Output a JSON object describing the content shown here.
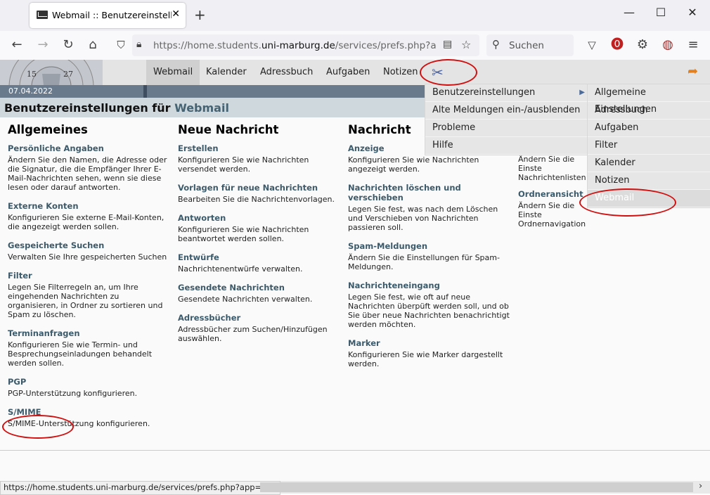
{
  "browser": {
    "tab_title": "Webmail :: Benutzereinstellunge",
    "url_prefix": "https://home.students.",
    "url_domain": "uni-marburg.de",
    "url_path": "/services/prefs.php?app=im",
    "search_placeholder": "Suchen",
    "status_url": "https://home.students.uni-marburg.de/services/prefs.php?app=imp"
  },
  "horde": {
    "seal_numbers": [
      "15",
      "27"
    ],
    "nav": [
      "Webmail",
      "Kalender",
      "Adressbuch",
      "Aufgaben",
      "Notizen"
    ],
    "date": "07.04.2022",
    "page_title_prefix": "Benutzereinstellungen für ",
    "page_title_app": "Webmail"
  },
  "columns": [
    {
      "title": "Allgemeines",
      "items": [
        {
          "label": "Persönliche Angaben",
          "desc": "Ändern Sie den Namen, die Adresse oder die Signatur, die die Empfänger Ihrer E-Mail-Nachrichten sehen, wenn sie diese lesen oder darauf antworten."
        },
        {
          "label": "Externe Konten",
          "desc": "Konfigurieren Sie externe E-Mail-Konten, die angezeigt werden sollen."
        },
        {
          "label": "Gespeicherte Suchen",
          "desc": "Verwalten Sie Ihre gespeicherten Suchen"
        },
        {
          "label": "Filter",
          "desc": "Legen Sie Filterregeln an, um Ihre eingehenden Nachrichten zu organisieren, in Ordner zu sortieren und Spam zu löschen."
        },
        {
          "label": "Terminanfragen",
          "desc": "Konfigurieren Sie wie Termin- und Besprechungseinladungen behandelt werden sollen."
        },
        {
          "label": "PGP",
          "desc": "PGP-Unterstützung konfigurieren."
        },
        {
          "label": "S/MIME",
          "desc": "S/MIME-Unterstützung konfigurieren."
        }
      ]
    },
    {
      "title": "Neue Nachricht",
      "items": [
        {
          "label": "Erstellen",
          "desc": "Konfigurieren Sie wie Nachrichten versendet werden."
        },
        {
          "label": "Vorlagen für neue Nachrichten",
          "desc": "Bearbeiten Sie die Nachrichtenvorlagen."
        },
        {
          "label": "Antworten",
          "desc": "Konfigurieren Sie wie Nachrichten beantwortet werden sollen."
        },
        {
          "label": "Entwürfe",
          "desc": "Nachrichtenentwürfe verwalten."
        },
        {
          "label": "Gesendete Nachrichten",
          "desc": "Gesendete Nachrichten verwalten."
        },
        {
          "label": "Adressbücher",
          "desc": "Adressbücher zum Suchen/Hinzufügen auswählen."
        }
      ]
    },
    {
      "title": "Nachricht",
      "items": [
        {
          "label": "Anzeige",
          "desc": "Konfigurieren Sie wie Nachrichten angezeigt werden."
        },
        {
          "label": "Nachrichten löschen und verschieben",
          "desc": "Legen Sie fest, was nach dem Löschen und Verschieben von Nachrichten passieren soll."
        },
        {
          "label": "Spam-Meldungen",
          "desc": "Ändern Sie die Einstellungen für Spam-Meldungen."
        },
        {
          "label": "Nachrichteneingang",
          "desc": "Legen Sie fest, wie oft auf neue Nachrichten überpüft werden soll, und ob Sie über neue Nachrichten benachrichtigt werden möchten."
        },
        {
          "label": "Marker",
          "desc": "Konfigurieren Sie wie Marker dargestellt werden."
        }
      ]
    },
    {
      "title": "",
      "items": [
        {
          "label": "",
          "desc": "Ändern Sie die Einste Nachrichtenlisten"
        },
        {
          "label": "Ordneransicht",
          "desc": "Ändern Sie die Einste Ordnernavigation"
        }
      ]
    }
  ],
  "menu_main": [
    {
      "label": "Benutzereinstellungen",
      "submenu": true
    },
    {
      "label": "Alte Meldungen ein-/ausblenden",
      "submenu": false
    },
    {
      "label": "Probleme",
      "submenu": false
    },
    {
      "label": "Hilfe",
      "submenu": false
    }
  ],
  "menu_sub": [
    "Allgemeine Einstellungen",
    "Adressbuch",
    "Aufgaben",
    "Filter",
    "Kalender",
    "Notizen",
    "Webmail"
  ],
  "colors": {
    "accent": "#456373",
    "annotation": "#d01010",
    "date_bar": "#687a8c"
  }
}
